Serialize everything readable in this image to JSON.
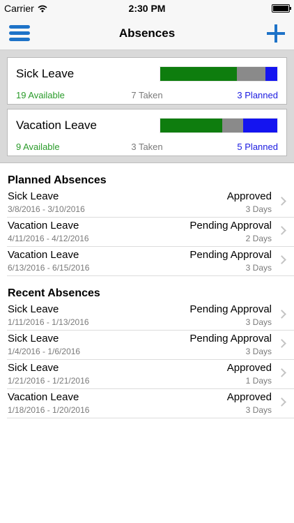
{
  "status_bar": {
    "carrier": "Carrier",
    "time": "2:30 PM"
  },
  "nav": {
    "title": "Absences",
    "menu_icon": "hamburger-menu-icon",
    "add_icon": "plus-icon"
  },
  "colors": {
    "accent": "#1e73c8",
    "available": "#2a9b2a",
    "taken": "#7a7a7a",
    "planned": "#1a1ae0",
    "bar_available": "#0e7d0e",
    "bar_taken": "#8a8a8a",
    "bar_planned": "#1414f0"
  },
  "balances": [
    {
      "name": "Sick Leave",
      "available": "19 Available",
      "taken": "7 Taken",
      "planned": "3 Planned",
      "bar": {
        "available": 19,
        "taken": 7,
        "planned": 3
      }
    },
    {
      "name": "Vacation Leave",
      "available": "9 Available",
      "taken": "3 Taken",
      "planned": "5 Planned",
      "bar": {
        "available": 9,
        "taken": 3,
        "planned": 5
      }
    }
  ],
  "planned": {
    "title": "Planned Absences",
    "items": [
      {
        "type": "Sick Leave",
        "status": "Approved",
        "dates": "3/8/2016 - 3/10/2016",
        "days": "3 Days"
      },
      {
        "type": "Vacation Leave",
        "status": "Pending Approval",
        "dates": "4/11/2016 - 4/12/2016",
        "days": "2 Days"
      },
      {
        "type": "Vacation Leave",
        "status": "Pending Approval",
        "dates": "6/13/2016 - 6/15/2016",
        "days": "3 Days"
      }
    ]
  },
  "recent": {
    "title": "Recent Absences",
    "items": [
      {
        "type": "Sick Leave",
        "status": "Pending Approval",
        "dates": "1/11/2016 - 1/13/2016",
        "days": "3 Days"
      },
      {
        "type": "Sick Leave",
        "status": "Pending Approval",
        "dates": "1/4/2016 - 1/6/2016",
        "days": "3 Days"
      },
      {
        "type": "Sick Leave",
        "status": "Approved",
        "dates": "1/21/2016 - 1/21/2016",
        "days": "1 Days"
      },
      {
        "type": "Vacation Leave",
        "status": "Approved",
        "dates": "1/18/2016 - 1/20/2016",
        "days": "3 Days"
      }
    ]
  }
}
